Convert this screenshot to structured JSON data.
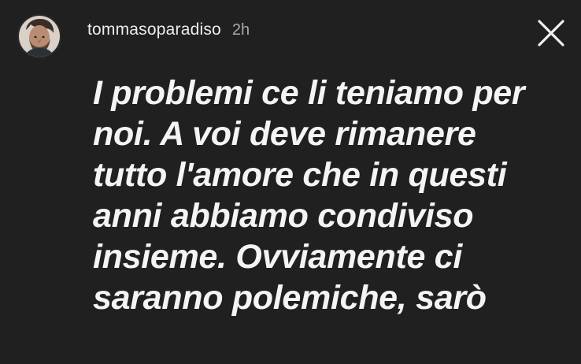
{
  "header": {
    "username": "tommasoparadiso",
    "timestamp": "2h",
    "avatar_icon": "avatar-icon",
    "close_icon": "close-icon"
  },
  "caption": {
    "lines": [
      "I problemi ce li teniamo per",
      "noi. A voi deve rimanere",
      "tutto l'amore che in questi",
      "anni abbiamo condiviso",
      "insieme. Ovviamente ci",
      "saranno polemiche, sarò"
    ]
  },
  "colors": {
    "background": "#202020",
    "text": "#f4f4f4",
    "username": "#ececec",
    "timestamp": "#a9a9a9"
  }
}
